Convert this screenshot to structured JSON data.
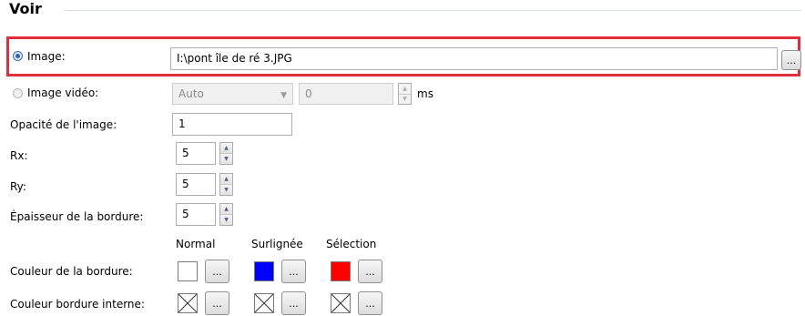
{
  "section": {
    "title": "Voir"
  },
  "image": {
    "label": "Image:",
    "value": "I:\\pont île de ré 3.JPG",
    "browse": "..."
  },
  "video": {
    "label": "Image vidéo:",
    "select_value": "Auto",
    "number_value": "0",
    "unit": "ms"
  },
  "opacity": {
    "label": "Opacité de l'image:",
    "value": "1"
  },
  "rx": {
    "label": "Rx:",
    "value": "5"
  },
  "ry": {
    "label": "Ry:",
    "value": "5"
  },
  "border_width": {
    "label": "Épaisseur de la bordure:",
    "value": "5"
  },
  "columns": {
    "normal": "Normal",
    "highlighted": "Surlignée",
    "selection": "Sélection"
  },
  "border_color": {
    "label": "Couleur de la bordure:",
    "normal_color": "#ffffff",
    "highlighted_color": "#0000ff",
    "selection_color": "#ff0000",
    "button": "..."
  },
  "inner_border": {
    "label": "Couleur bordure interne:",
    "button": "..."
  }
}
